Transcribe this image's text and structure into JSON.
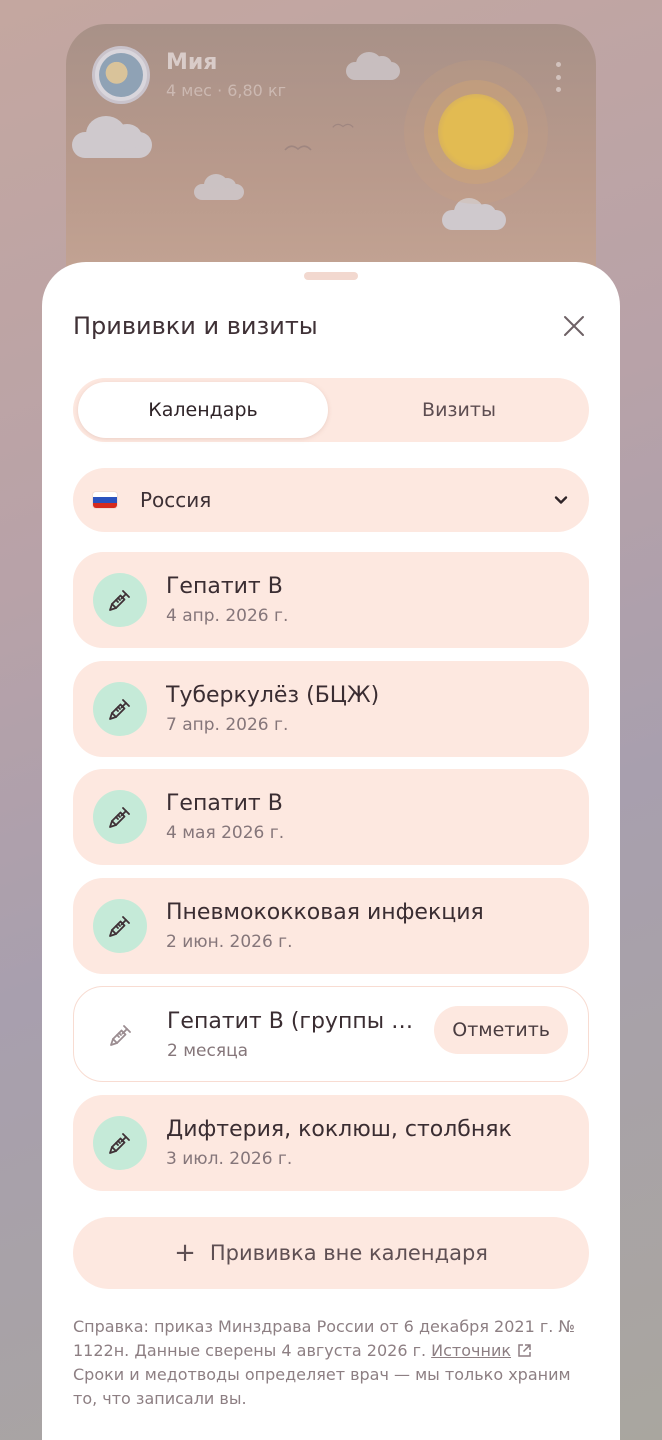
{
  "profile": {
    "name": "Мия",
    "meta": "4 мес · 6,80 кг"
  },
  "sheet": {
    "title": "Прививки и визиты"
  },
  "tabs": [
    {
      "label": "Календарь",
      "active": true
    },
    {
      "label": "Визиты",
      "active": false
    }
  ],
  "country": {
    "label": "Россия",
    "flag_colors": [
      "#ffffff",
      "#2a52be",
      "#d52b1e"
    ]
  },
  "vaccinations": [
    {
      "name": "Гепатит В",
      "date": "4 апр. 2026 г.",
      "done": true
    },
    {
      "name": "Туберкулёз (БЦЖ)",
      "date": "7 апр. 2026 г.",
      "done": true
    },
    {
      "name": "Гепатит В",
      "date": "4 мая 2026 г.",
      "done": true
    },
    {
      "name": "Пневмококковая инфекция",
      "date": "2 июн. 2026 г.",
      "done": true
    },
    {
      "name": "Гепатит В (группы риска)",
      "date": "2 месяца",
      "done": false,
      "action": "Отметить"
    },
    {
      "name": "Дифтерия, коклюш, столбняк",
      "date": "3 июл. 2026 г.",
      "done": true
    }
  ],
  "add_button": {
    "label": "Прививка вне календаря"
  },
  "footnote": {
    "text_before": "Справка: приказ Минздрава России от 6 декабря 2021 г. № 1122н. Данные сверены 4 августа 2026 г. ",
    "link": "Источник",
    "text_after": "Сроки и медотводы определяет врач — мы только храним то, что записали вы."
  },
  "colors": {
    "accent_bg": "#fde8e0",
    "icon_bg": "#c5ead8",
    "text_primary": "#3a2d32"
  }
}
